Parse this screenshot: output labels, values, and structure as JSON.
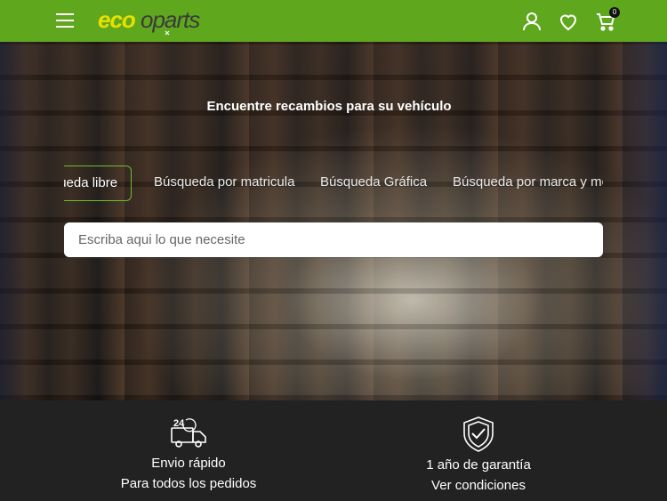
{
  "header": {
    "logo_text": "ecooparts",
    "cart_count": "0",
    "menu_icon": "hamburger-menu-icon",
    "account_icon": "user-icon",
    "wishlist_icon": "heart-icon",
    "cart_icon": "cart-icon",
    "brand_color": "#5fa81e",
    "logo_color": "#e8e000"
  },
  "hero": {
    "title": "Encuentre recambios para su vehículo",
    "tabs": [
      {
        "label": "Búsqueda libre",
        "active": true
      },
      {
        "label": "Búsqueda por matricula",
        "active": false
      },
      {
        "label": "Búsqueda Gráfica",
        "active": false
      },
      {
        "label": "Búsqueda por marca y modelo",
        "active": false
      }
    ],
    "search": {
      "placeholder": "Escriba aqui lo que necesite",
      "value": ""
    }
  },
  "features": [
    {
      "icon": "delivery-truck-24h-icon",
      "title": "Envio rápido",
      "subtitle": "Para todos los pedidos"
    },
    {
      "icon": "shield-check-icon",
      "title": "1 año de garantía",
      "subtitle": "Ver condiciones"
    }
  ]
}
